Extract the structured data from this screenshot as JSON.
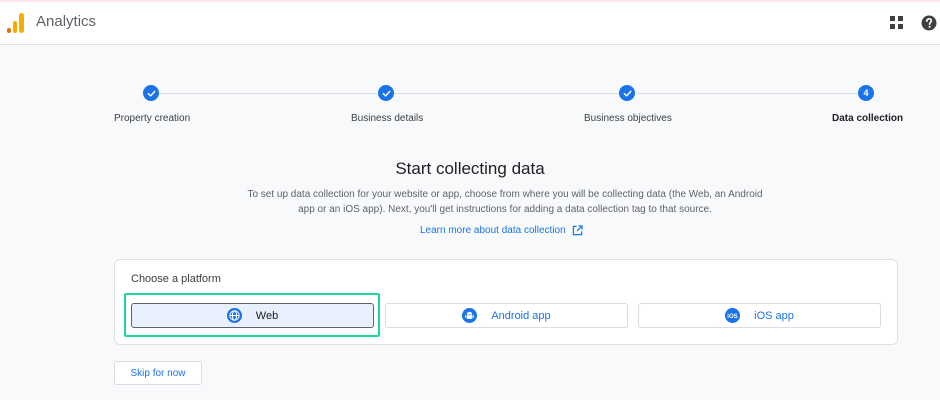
{
  "app": {
    "title": "Analytics",
    "accent": "#1a73e8",
    "logo_colors": [
      "#f9ab00",
      "#e37400"
    ]
  },
  "header": {
    "apps_icon": "apps-grid-icon",
    "help_icon": "help-icon"
  },
  "stepper": {
    "steps": [
      {
        "label": "Property creation",
        "state": "done",
        "marker": ""
      },
      {
        "label": "Business details",
        "state": "done",
        "marker": ""
      },
      {
        "label": "Business objectives",
        "state": "done",
        "marker": ""
      },
      {
        "label": "Data collection",
        "state": "current",
        "marker": "4"
      }
    ]
  },
  "main": {
    "heading": "Start collecting data",
    "description_line1": "To set up data collection for your website or app, choose from where you will be collecting data (the Web, an Android",
    "description_line2": "app or an iOS app). Next, you'll get instructions for adding a data collection tag to that source.",
    "learn_more": "Learn more about data collection"
  },
  "platform": {
    "label": "Choose a platform",
    "options": [
      {
        "label": "Web",
        "icon": "globe-icon",
        "selected": true
      },
      {
        "label": "Android app",
        "icon": "android-icon",
        "selected": false
      },
      {
        "label": "iOS app",
        "icon": "ios-icon",
        "icon_text": "iOS",
        "selected": false
      }
    ],
    "highlight_color": "#1ed6a0"
  },
  "footer": {
    "skip_label": "Skip for now"
  }
}
